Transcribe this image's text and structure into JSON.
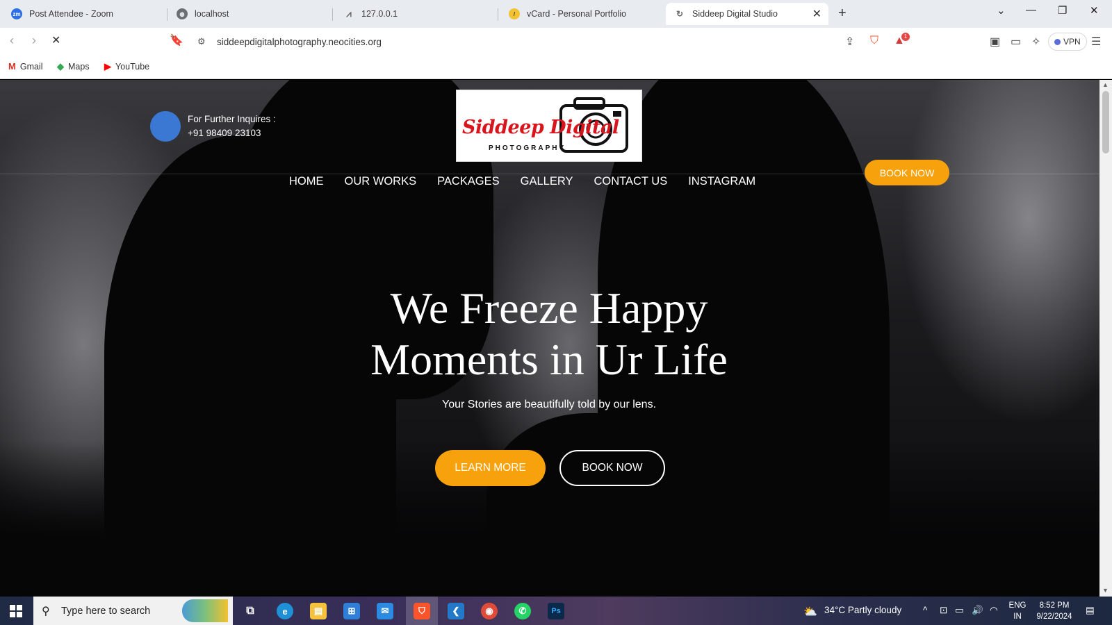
{
  "browser": {
    "tabs": [
      {
        "title": "Post Attendee - Zoom",
        "icon": "zoom-icon"
      },
      {
        "title": "localhost",
        "icon": "globe-icon"
      },
      {
        "title": "127.0.0.1",
        "icon": "xampp-icon"
      },
      {
        "title": "vCard - Personal Portfolio",
        "icon": "vcard-icon"
      },
      {
        "title": "Siddeep Digital Studio",
        "icon": "loading-icon",
        "active": true
      }
    ],
    "url": "siddeepdigitalphotography.neocities.org",
    "vpn_label": "VPN",
    "notification_count": "1",
    "bookmarks": [
      {
        "label": "Gmail",
        "icon": "gmail-icon"
      },
      {
        "label": "Maps",
        "icon": "maps-icon"
      },
      {
        "label": "YouTube",
        "icon": "youtube-icon"
      }
    ]
  },
  "site": {
    "inquiry_label": "For Further Inquires :",
    "inquiry_phone": "+91 98409 23103",
    "logo_script": "Siddeep Digital",
    "logo_sub": "PHOTOGRAPHY",
    "book_now_top": "BOOK NOW",
    "nav": [
      "HOME",
      "OUR WORKS",
      "PACKAGES",
      "GALLERY",
      "CONTACT US",
      "INSTAGRAM"
    ],
    "headline_line1": "We Freeze Happy",
    "headline_line2": "Moments in Ur Life",
    "subline": "Your Stories are beautifully told by our lens.",
    "learn_more": "LEARN MORE",
    "book_now": "BOOK NOW",
    "accent_color": "#f7a10c"
  },
  "taskbar": {
    "search_placeholder": "Type here to search",
    "weather": "34°C  Partly cloudy",
    "lang_top": "ENG",
    "lang_bottom": "IN",
    "time": "8:52 PM",
    "date": "9/22/2024"
  }
}
